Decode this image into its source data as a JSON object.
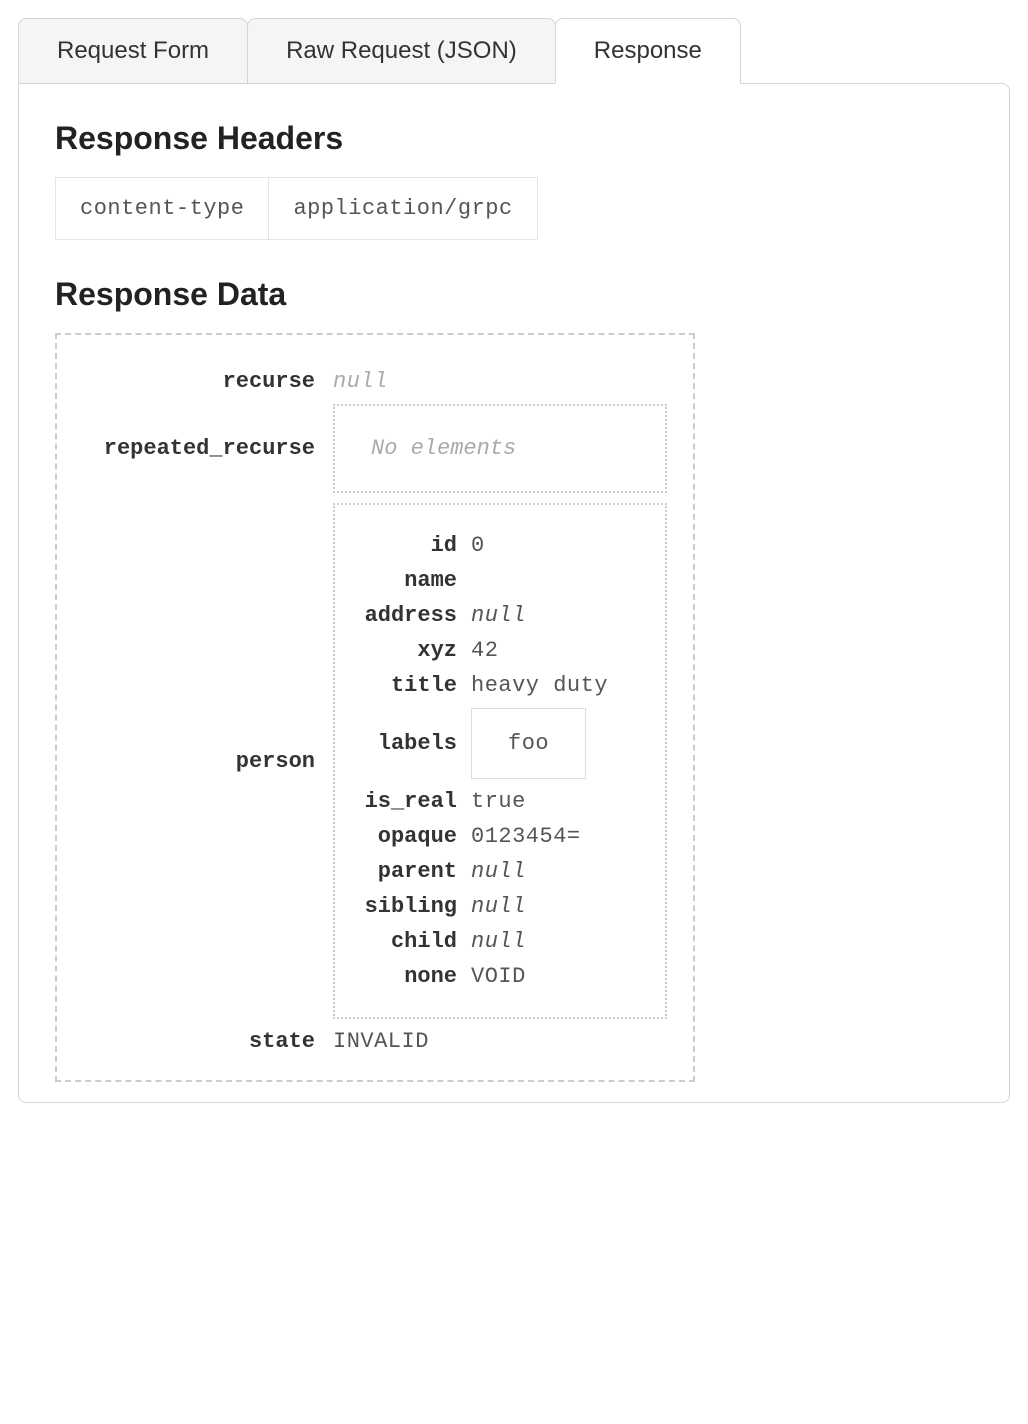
{
  "tabs": [
    {
      "label": "Request Form",
      "active": false
    },
    {
      "label": "Raw Request (JSON)",
      "active": false
    },
    {
      "label": "Response",
      "active": true
    }
  ],
  "response": {
    "headers_title": "Response Headers",
    "headers": [
      {
        "key": "content-type",
        "value": "application/grpc"
      }
    ],
    "data_title": "Response Data",
    "fields": {
      "recurse": {
        "label": "recurse",
        "value": "null",
        "null": true
      },
      "repeated_recurse": {
        "label": "repeated_recurse",
        "placeholder": "No elements"
      },
      "person": {
        "label": "person",
        "fields": {
          "id": {
            "label": "id",
            "value": "0"
          },
          "name": {
            "label": "name",
            "value": ""
          },
          "address": {
            "label": "address",
            "value": "null",
            "null": true
          },
          "xyz": {
            "label": "xyz",
            "value": "42"
          },
          "title": {
            "label": "title",
            "value": "heavy duty"
          },
          "labels": {
            "label": "labels",
            "items": [
              "foo"
            ]
          },
          "is_real": {
            "label": "is_real",
            "value": "true"
          },
          "opaque": {
            "label": "opaque",
            "value": "0123454="
          },
          "parent": {
            "label": "parent",
            "value": "null",
            "null": true
          },
          "sibling": {
            "label": "sibling",
            "value": "null",
            "null": true
          },
          "child": {
            "label": "child",
            "value": "null",
            "null": true
          },
          "none": {
            "label": "none",
            "value": "VOID"
          }
        }
      },
      "state": {
        "label": "state",
        "value": "INVALID"
      }
    }
  }
}
